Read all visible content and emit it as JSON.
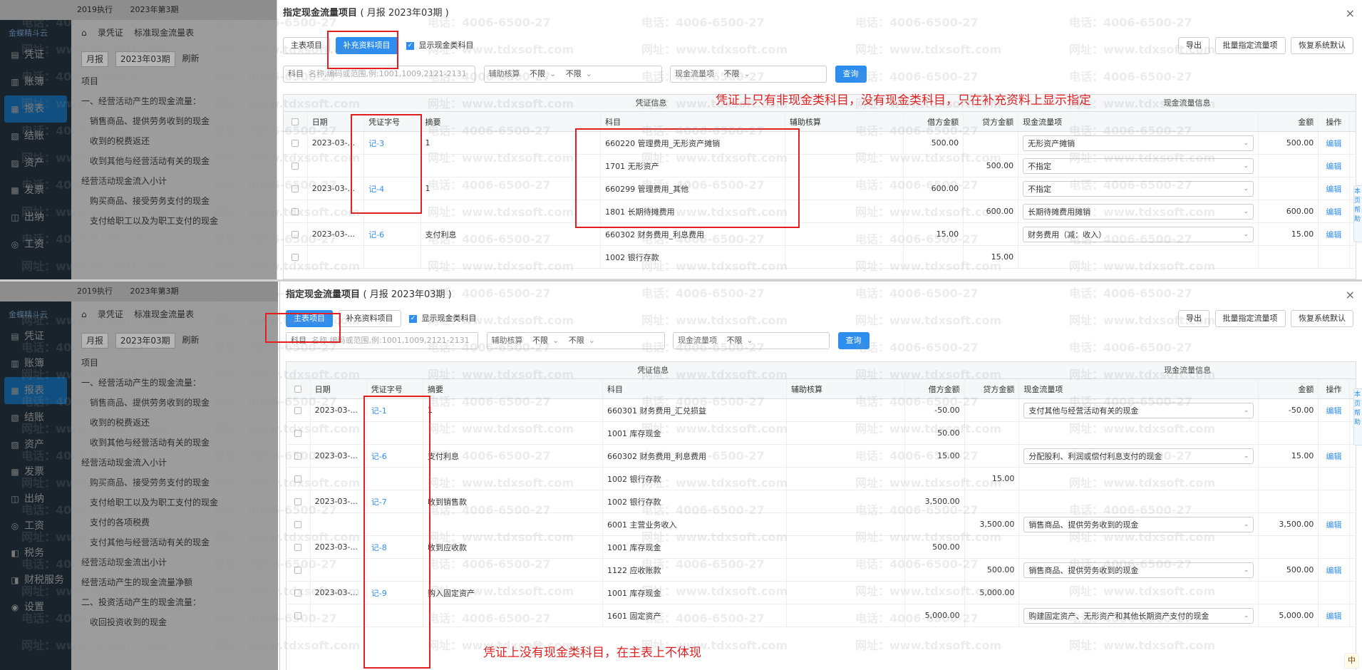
{
  "background_app": {
    "logo": "金蝶精斗云",
    "year_selector": "2019执行",
    "period_badge": "2023年第3期",
    "tabs": [
      "录凭证",
      "标准现金流量表"
    ],
    "period_select": "月报",
    "period_value": "2023年03期",
    "refresh": "刷新",
    "column_header": "项目",
    "sidebar_top": [
      "凭证",
      "账簿",
      "报表",
      "结账",
      "资产",
      "发票",
      "出纳",
      "工资"
    ],
    "sidebar_bottom": [
      "凭证",
      "账簿",
      "报表",
      "结账",
      "资产",
      "发票",
      "出纳",
      "工资",
      "税务",
      "财税服务",
      "设置"
    ],
    "rows_top": [
      {
        "text": "一、经营活动产生的现金流量：",
        "indent": false
      },
      {
        "text": "销售商品、提供劳务收到的现金",
        "indent": true
      },
      {
        "text": "收到的税费返还",
        "indent": true
      },
      {
        "text": "收到其他与经营活动有关的现金",
        "indent": true
      },
      {
        "text": "经营活动现金流入小计",
        "indent": false
      },
      {
        "text": "购买商品、接受劳务支付的现金",
        "indent": true
      },
      {
        "text": "支付给职工以及为职工支付的现金",
        "indent": true
      }
    ],
    "rows_bottom": [
      {
        "text": "一、经营活动产生的现金流量：",
        "indent": false
      },
      {
        "text": "销售商品、提供劳务收到的现金",
        "indent": true
      },
      {
        "text": "收到的税费返还",
        "indent": true
      },
      {
        "text": "收到其他与经营活动有关的现金",
        "indent": true
      },
      {
        "text": "经营活动现金流入小计",
        "indent": false
      },
      {
        "text": "购买商品、接受劳务支付的现金",
        "indent": true
      },
      {
        "text": "支付给职工以及为职工支付的现金",
        "indent": true
      },
      {
        "text": "支付的各项税费",
        "indent": true
      },
      {
        "text": "支付其他与经营活动有关的现金",
        "indent": true
      },
      {
        "text": "经营活动现金流出小计",
        "indent": false
      },
      {
        "text": "经营活动产生的现金流量净额",
        "indent": false
      },
      {
        "text": "二、投资活动产生的现金流量：",
        "indent": false
      },
      {
        "text": "收回投资收到的现金",
        "indent": true
      }
    ]
  },
  "dialog": {
    "title": "指定现金流量项目",
    "subtitle": "( 月报 2023年03期 )",
    "close": "×",
    "tab_main": "主表项目",
    "tab_supp": "补充资料项目",
    "show_cash_label": "显示现金类科目",
    "btn_export": "导出",
    "btn_batch": "批量指定流量项",
    "btn_restore": "恢复系统默认",
    "filter_subject_label": "科目",
    "filter_subject_placeholder": "名称,编码或范围,例:1001,1009,2121-2131",
    "filter_aux_label": "辅助核算",
    "filter_aux_v1": "不限",
    "filter_aux_v2": "不限",
    "filter_cash_label": "现金流量项",
    "filter_cash_value": "不限",
    "btn_query": "查询",
    "group_voucher": "凭证信息",
    "group_cash": "现金流量信息",
    "headers": {
      "date": "日期",
      "voucher_no": "凭证字号",
      "summary": "摘要",
      "subject": "科目",
      "aux": "辅助核算",
      "debit": "借方金额",
      "credit": "贷方金额",
      "cash_item": "现金流量项",
      "amount": "金额",
      "op": "操作"
    }
  },
  "top_rows": [
    {
      "date": "2023-03-...",
      "vno": "记-3",
      "summary": "1",
      "subject": "660220 管理费用_无形资产摊销",
      "debit": "500.00",
      "credit": "",
      "cash": "无形资产摊销",
      "amount": "500.00",
      "op": "编辑"
    },
    {
      "date": "",
      "vno": "",
      "summary": "",
      "subject": "1701 无形资产",
      "debit": "",
      "credit": "500.00",
      "cash": "不指定",
      "amount": "",
      "op": "编辑"
    },
    {
      "date": "2023-03-...",
      "vno": "记-4",
      "summary": "1",
      "subject": "660299 管理费用_其他",
      "debit": "600.00",
      "credit": "",
      "cash": "不指定",
      "amount": "",
      "op": "编辑"
    },
    {
      "date": "",
      "vno": "",
      "summary": "",
      "subject": "1801 长期待摊费用",
      "debit": "",
      "credit": "600.00",
      "cash": "长期待摊费用摊销",
      "amount": "600.00",
      "op": "编辑"
    },
    {
      "date": "2023-03-...",
      "vno": "记-6",
      "summary": "支付利息",
      "subject": "660302 财务费用_利息费用",
      "debit": "15.00",
      "credit": "",
      "cash": "财务费用（减：收入）",
      "amount": "15.00",
      "op": "编辑"
    },
    {
      "date": "",
      "vno": "",
      "summary": "",
      "subject": "1002 银行存款",
      "debit": "",
      "credit": "15.00",
      "cash": "",
      "amount": "",
      "op": ""
    }
  ],
  "bottom_rows": [
    {
      "date": "2023-03-...",
      "vno": "记-1",
      "summary": "1",
      "subject": "660301 财务费用_汇兑损益",
      "debit": "-50.00",
      "credit": "",
      "cash": "支付其他与经营活动有关的现金",
      "amount": "-50.00",
      "op": "编辑"
    },
    {
      "date": "",
      "vno": "",
      "summary": "",
      "subject": "1001 库存现金",
      "debit": "50.00",
      "credit": "",
      "cash": "",
      "amount": "",
      "op": ""
    },
    {
      "date": "2023-03-...",
      "vno": "记-6",
      "summary": "支付利息",
      "subject": "660302 财务费用_利息费用",
      "debit": "15.00",
      "credit": "",
      "cash": "分配股利、利润或偿付利息支付的现金",
      "amount": "15.00",
      "op": "编辑"
    },
    {
      "date": "",
      "vno": "",
      "summary": "",
      "subject": "1002 银行存款",
      "debit": "",
      "credit": "15.00",
      "cash": "",
      "amount": "",
      "op": ""
    },
    {
      "date": "2023-03-...",
      "vno": "记-7",
      "summary": "收到销售款",
      "subject": "1002 银行存款",
      "debit": "3,500.00",
      "credit": "",
      "cash": "",
      "amount": "",
      "op": ""
    },
    {
      "date": "",
      "vno": "",
      "summary": "",
      "subject": "6001 主营业务收入",
      "debit": "",
      "credit": "3,500.00",
      "cash": "销售商品、提供劳务收到的现金",
      "amount": "3,500.00",
      "op": "编辑"
    },
    {
      "date": "2023-03-...",
      "vno": "记-8",
      "summary": "收到应收款",
      "subject": "1001 库存现金",
      "debit": "500.00",
      "credit": "",
      "cash": "",
      "amount": "",
      "op": ""
    },
    {
      "date": "",
      "vno": "",
      "summary": "",
      "subject": "1122 应收账款",
      "debit": "",
      "credit": "500.00",
      "cash": "销售商品、提供劳务收到的现金",
      "amount": "500.00",
      "op": "编辑"
    },
    {
      "date": "2023-03-...",
      "vno": "记-9",
      "summary": "购入固定资产",
      "subject": "1001 库存现金",
      "debit": "",
      "credit": "5,000.00",
      "cash": "",
      "amount": "",
      "op": ""
    },
    {
      "date": "",
      "vno": "",
      "summary": "",
      "subject": "1601 固定资产",
      "debit": "5,000.00",
      "credit": "",
      "cash": "购建固定资产、无形资产和其他长期资产支付的现金",
      "amount": "5,000.00",
      "op": "编辑"
    }
  ],
  "annotations": {
    "top": "凭证上只有非现金类科目，没有现金类科目，只在补充资料上显示指定",
    "bottom": "凭证上没有现金类科目，在主表上不体现"
  },
  "watermark": {
    "phone": "电话：4006-6500-27",
    "site": "网址：www.tdxsoft.com"
  },
  "side_tab": "本页帮助",
  "ime": "中"
}
